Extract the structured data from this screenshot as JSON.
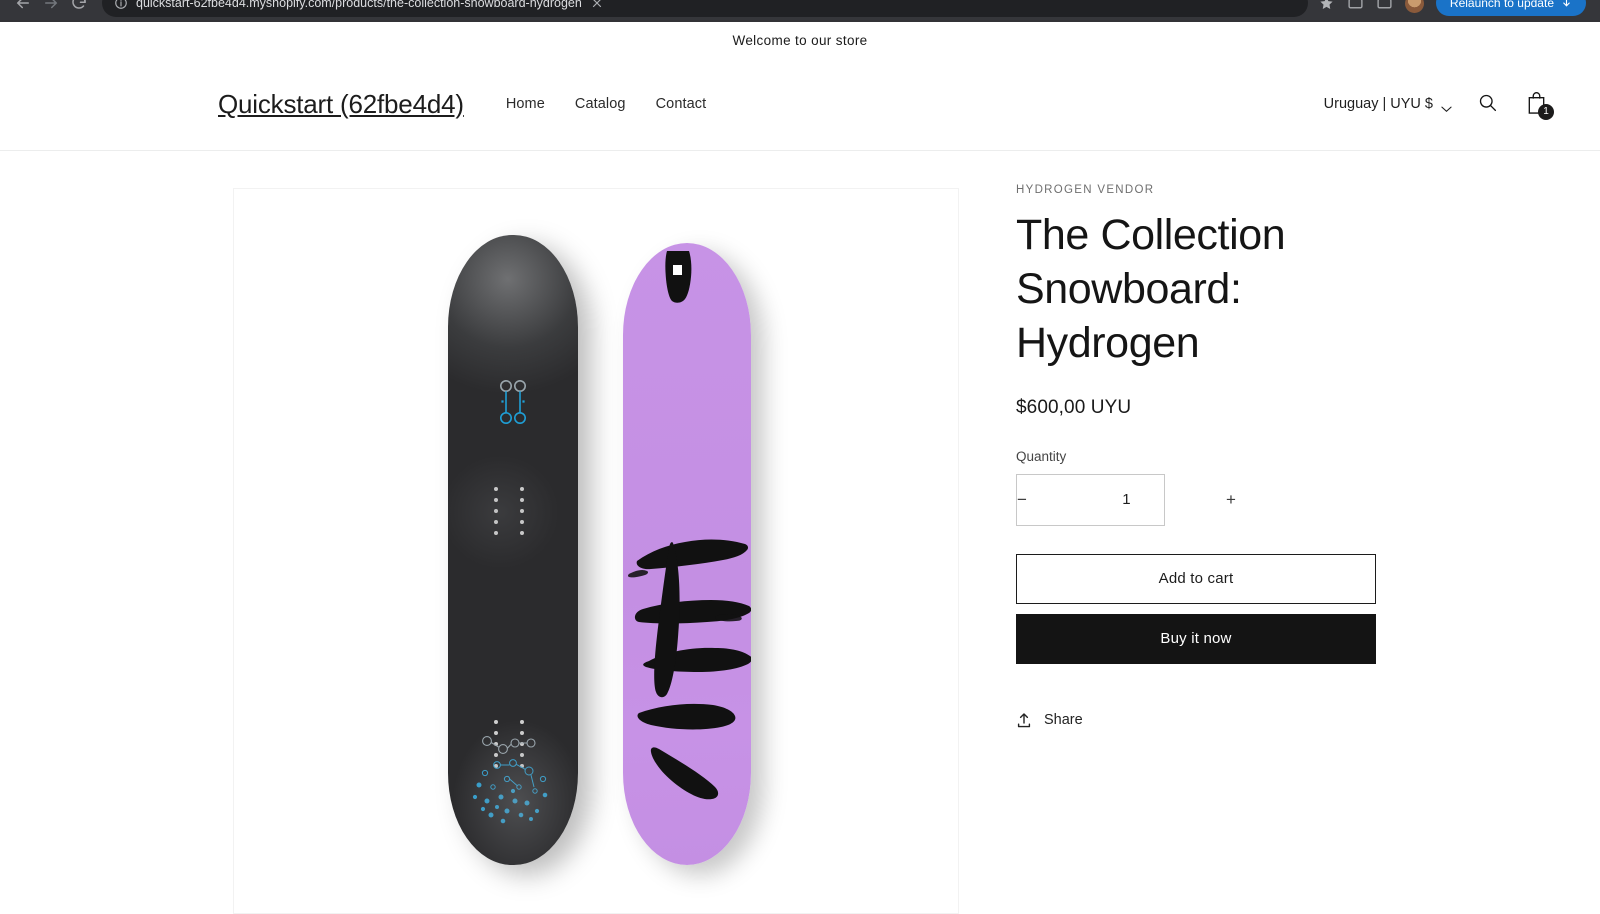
{
  "browser": {
    "url": "quickstart-62fbe4d4.myshopify.com/products/the-collection-snowboard-hydrogen",
    "update_button_label": "Relaunch to update",
    "back_icon": "back-arrow-icon",
    "forward_icon": "forward-arrow-icon",
    "reload_icon": "reload-icon",
    "site_info_icon": "site-info-icon",
    "bookmark_icon": "bookmark-star-icon",
    "extensions_icon": "extensions-icon",
    "profile_icon": "profile-avatar-icon"
  },
  "announcement": {
    "text": "Welcome to our store"
  },
  "header": {
    "store_name": "Quickstart (62fbe4d4)",
    "nav": [
      {
        "label": "Home"
      },
      {
        "label": "Catalog"
      },
      {
        "label": "Contact"
      }
    ],
    "locale": {
      "label": "Uruguay | UYU $",
      "chevron_icon": "chevron-down-icon"
    },
    "search_icon": "search-icon",
    "cart_icon": "shopping-bag-icon",
    "cart_count": "1"
  },
  "product": {
    "vendor": "HYDROGEN VENDOR",
    "title": "The Collection Snowboard: Hydrogen",
    "price": "$600,00 UYU",
    "quantity_label": "Quantity",
    "quantity_value": "1",
    "quantity_decrease_label": "−",
    "quantity_increase_label": "+",
    "add_to_cart_label": "Add to cart",
    "buy_now_label": "Buy it now",
    "share_label": "Share",
    "share_icon": "share-upload-icon",
    "media_alt": "The Collection Snowboard: Hydrogen — dark board and lavender board",
    "colors": {
      "board_light": "#C48FE3",
      "board_dark": "#262628",
      "buy_now_bg": "#141414",
      "logo_blue": "#1f9fd6"
    }
  }
}
